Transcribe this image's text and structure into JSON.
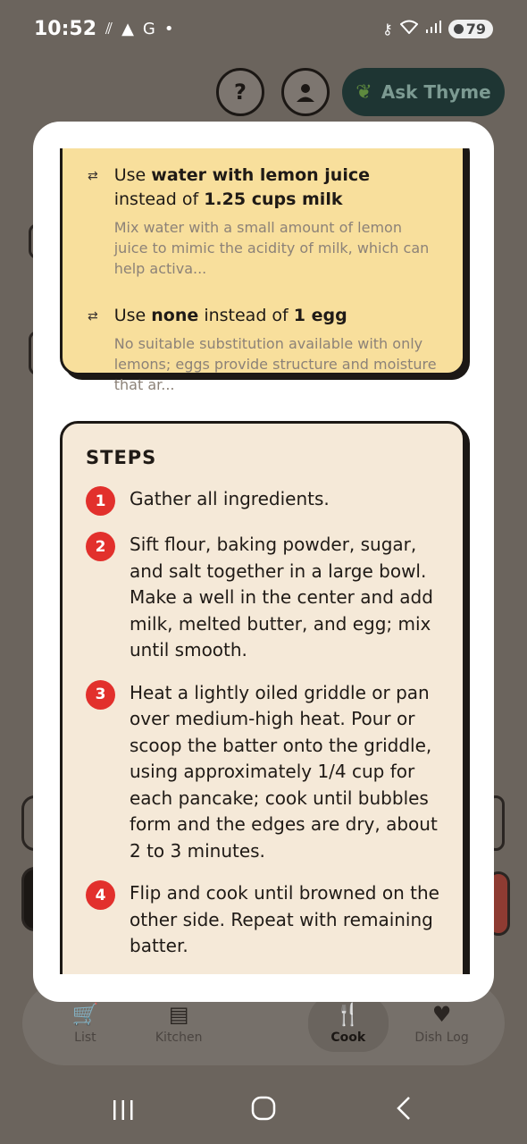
{
  "status_bar": {
    "time": "10:52",
    "left_icons": [
      "signal-glyph-icon",
      "shopping-bag-icon",
      "google-icon",
      "dot-icon"
    ],
    "right_icons": [
      "key-icon",
      "wifi-icon",
      "cellular-signal-icon"
    ],
    "battery": "79"
  },
  "header": {
    "help_label": "?",
    "ask_label": "Ask Thyme"
  },
  "substitutions": [
    {
      "pre": "Use ",
      "use": "water with lemon juice",
      "mid": " instead of ",
      "of": "1.25 cups milk",
      "description": "Mix water with a small amount of lemon juice to mimic the acidity of milk, which can help activa..."
    },
    {
      "pre": "Use ",
      "use": "none",
      "mid": " instead of ",
      "of": "1 egg",
      "description": "No suitable substitution available with only lemons; eggs provide structure and moisture that ar..."
    }
  ],
  "steps": {
    "title": "STEPS",
    "items": [
      {
        "num": "1",
        "text": "Gather all ingredients."
      },
      {
        "num": "2",
        "text": "Sift flour, baking powder, sugar, and salt together in a large bowl. Make a well in the center and add milk, melted butter, and egg; mix until smooth."
      },
      {
        "num": "3",
        "text": "Heat a lightly oiled griddle or pan over medium-high heat. Pour or scoop the batter onto the griddle, using approximately 1/4 cup for each pancake; cook until bubbles form and the edges are dry, about 2 to 3 minutes."
      },
      {
        "num": "4",
        "text": "Flip and cook until browned on the other side. Repeat with remaining batter."
      }
    ]
  },
  "bottom_nav": [
    {
      "label": "List",
      "icon": "cart-icon"
    },
    {
      "label": "Kitchen",
      "icon": "fridge-icon"
    },
    {
      "label": "Cook",
      "icon": "fork-knife-icon"
    },
    {
      "label": "Dish Log",
      "icon": "heart-icon"
    }
  ],
  "colors": {
    "accent_red": "#e2302c",
    "subs_card": "#f8df9c",
    "steps_card": "#f5e9d8",
    "ask_button": "#1e3533"
  }
}
